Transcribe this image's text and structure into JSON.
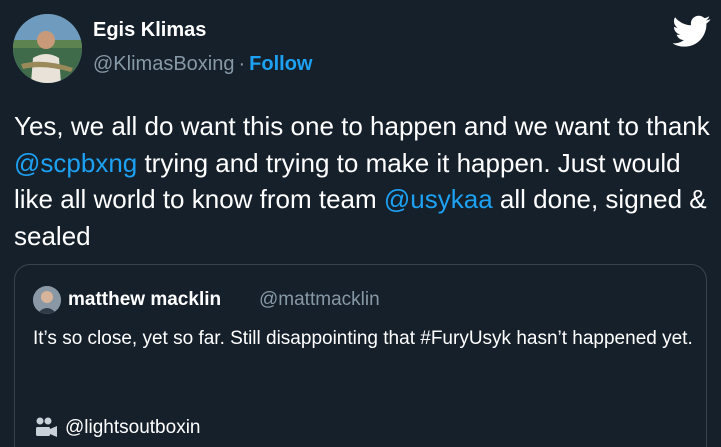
{
  "tweet": {
    "author": {
      "name": "Egis Klimas",
      "handle": "@KlimasBoxing",
      "separator": "·",
      "follow_label": "Follow"
    },
    "text": {
      "part1": "Yes, we all do want this one to happen and we want to thank ",
      "mention1": "@scpbxng",
      "part2": " trying and trying to make it happen. Just would like all world to know from team ",
      "mention2": "@usykaa",
      "part3": " all done, signed & sealed"
    },
    "quote": {
      "name": "matthew macklin",
      "handle": "@mattmacklin",
      "text": "It’s so close, yet so far. Still disappointing that #FuryUsyk hasn’t happened yet.",
      "embed_link": "@lightsoutboxin"
    }
  },
  "colors": {
    "background": "#15202b",
    "accent": "#1da1f2",
    "secondary_text": "#8899a6",
    "border": "#38444d"
  },
  "icons": {
    "logo": "twitter-bird-icon",
    "media": "video-camera-icon"
  }
}
